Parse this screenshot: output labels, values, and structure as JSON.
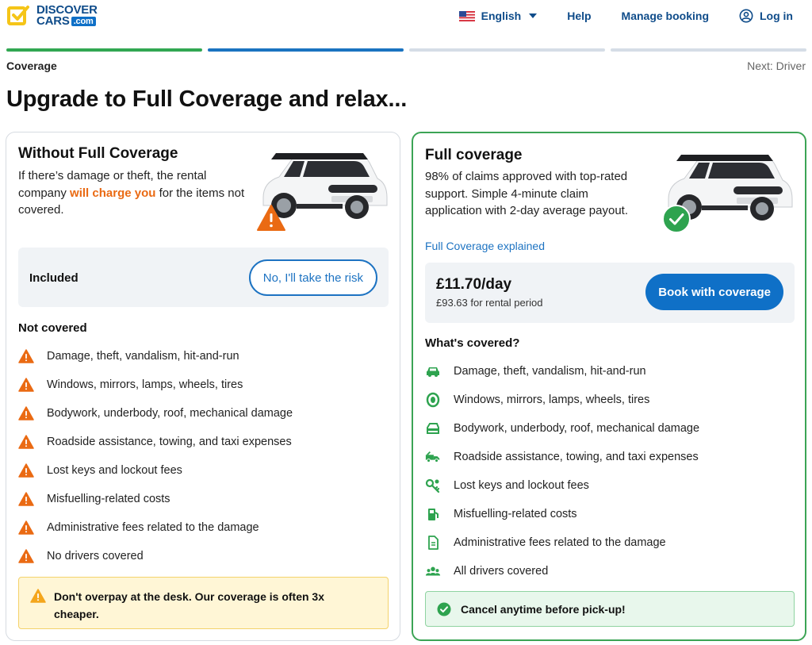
{
  "header": {
    "logo_line1": "DISCOVER",
    "logo_line2": "CARS",
    "logo_suffix": ".com",
    "language": "English",
    "help": "Help",
    "manage_booking": "Manage booking",
    "login": "Log in"
  },
  "progress": {
    "current_step": "Coverage",
    "next_step": "Next: Driver"
  },
  "page_title": "Upgrade to Full Coverage and relax...",
  "left_card": {
    "title": "Without Full Coverage",
    "desc_before": "If there’s damage or theft, the rental company ",
    "desc_highlight": "will charge you",
    "desc_after": " for the items not covered.",
    "included_label": "Included",
    "decline_button": "No, I'll take the risk",
    "list_title": "Not covered",
    "items": [
      "Damage, theft, vandalism, hit-and-run",
      "Windows, mirrors, lamps, wheels, tires",
      "Bodywork, underbody, roof, mechanical damage",
      "Roadside assistance, towing, and taxi expenses",
      "Lost keys and lockout fees",
      "Misfuelling-related costs",
      "Administrative fees related to the damage",
      "No drivers covered"
    ],
    "note": "Don't overpay at the desk. Our coverage is often 3x cheaper."
  },
  "right_card": {
    "title": "Full coverage",
    "desc": "98% of claims approved with top-rated support. Simple 4-minute claim application with 2-day average payout.",
    "explained_link": "Full Coverage explained",
    "price": "£11.70/day",
    "price_period": "£93.63 for rental period",
    "book_button": "Book with coverage",
    "list_title": "What's covered?",
    "items": [
      "Damage, theft, vandalism, hit-and-run",
      "Windows, mirrors, lamps, wheels, tires",
      "Bodywork, underbody, roof, mechanical damage",
      "Roadside assistance, towing, and taxi expenses",
      "Lost keys and lockout fees",
      "Misfuelling-related costs",
      "Administrative fees related to the damage",
      "All drivers covered"
    ],
    "note": "Cancel anytime before pick-up!"
  },
  "colors": {
    "brand_blue": "#0f70c7",
    "link_blue": "#1d73c2",
    "warning_orange": "#ea6a13",
    "success_green": "#31a752",
    "logo_yellow": "#f5c518"
  },
  "icons": {
    "not_covered": "warning-triangle-icon",
    "covered": [
      "car-icon",
      "tire-icon",
      "car-body-icon",
      "tow-truck-icon",
      "key-icon",
      "fuel-pump-icon",
      "document-icon",
      "group-icon"
    ]
  }
}
